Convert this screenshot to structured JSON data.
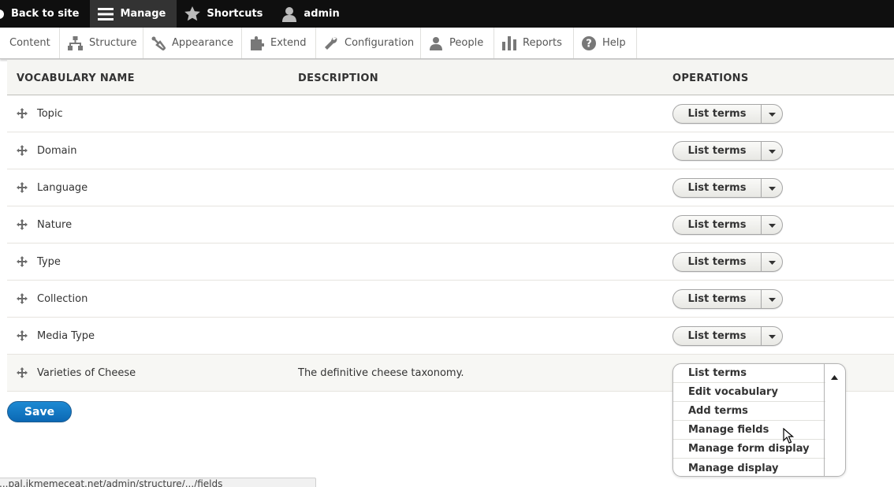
{
  "toolbar": {
    "back_label": "Back to site",
    "manage_label": "Manage",
    "shortcuts_label": "Shortcuts",
    "user_label": "admin"
  },
  "tray": {
    "items": [
      {
        "label": "Content",
        "icon": "content-icon"
      },
      {
        "label": "Structure",
        "icon": "structure-icon"
      },
      {
        "label": "Appearance",
        "icon": "appearance-icon"
      },
      {
        "label": "Extend",
        "icon": "extend-icon"
      },
      {
        "label": "Configuration",
        "icon": "configuration-icon"
      },
      {
        "label": "People",
        "icon": "people-icon"
      },
      {
        "label": "Reports",
        "icon": "reports-icon"
      },
      {
        "label": "Help",
        "icon": "help-icon"
      }
    ]
  },
  "table": {
    "headers": {
      "name": "VOCABULARY NAME",
      "description": "DESCRIPTION",
      "operations": "OPERATIONS"
    },
    "rows": [
      {
        "name": "Topic",
        "description": "",
        "operation": "List terms"
      },
      {
        "name": "Domain",
        "description": "",
        "operation": "List terms"
      },
      {
        "name": "Language",
        "description": "",
        "operation": "List terms"
      },
      {
        "name": "Nature",
        "description": "",
        "operation": "List terms"
      },
      {
        "name": "Type",
        "description": "",
        "operation": "List terms"
      },
      {
        "name": "Collection",
        "description": "",
        "operation": "List terms"
      },
      {
        "name": "Media Type",
        "description": "",
        "operation": "List terms"
      },
      {
        "name": "Varieties of Cheese",
        "description": "The definitive cheese taxonomy.",
        "operation": "List terms"
      }
    ]
  },
  "dropdown": {
    "items": [
      "List terms",
      "Edit vocabulary",
      "Add terms",
      "Manage fields",
      "Manage form display",
      "Manage display"
    ]
  },
  "save_label": "Save",
  "status_url": "...pal.ikmemeceat.net/admin/structure/.../fields",
  "colors": {
    "toolbar_bg": "#0f0f0f",
    "save_blue": "#0b68b4"
  }
}
